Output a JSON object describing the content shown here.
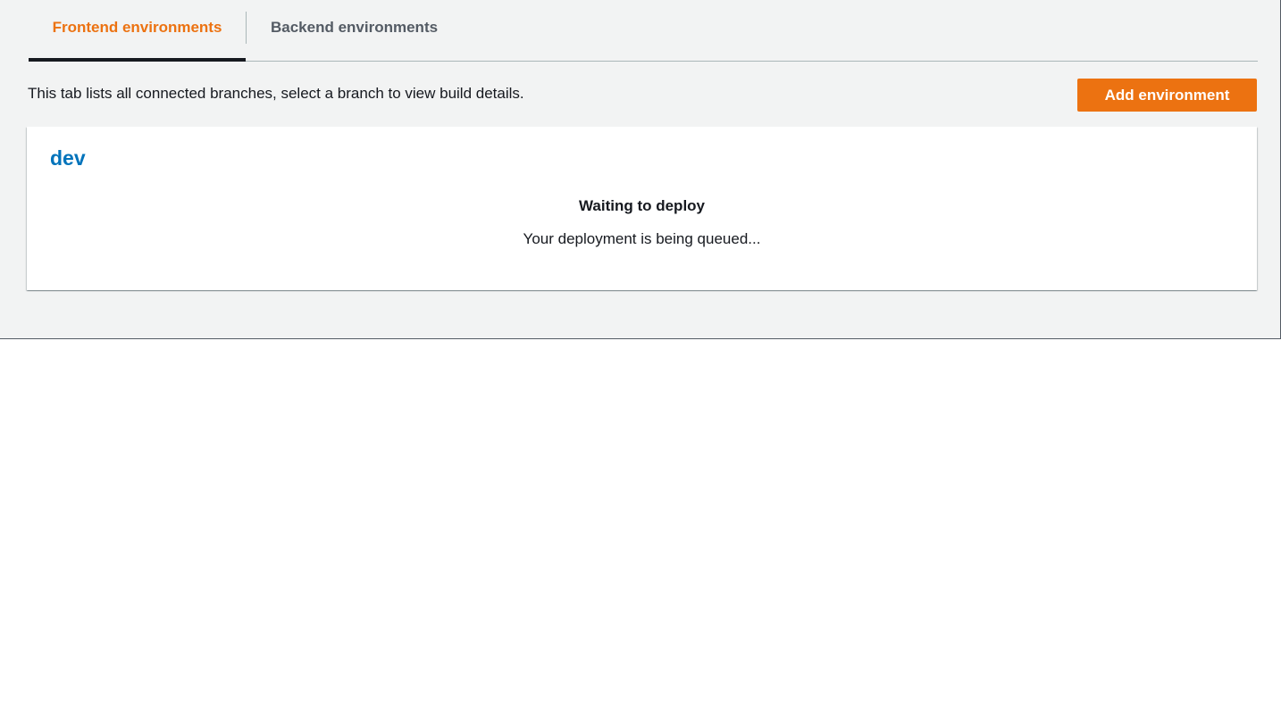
{
  "tabs": [
    {
      "label": "Frontend environments",
      "active": true
    },
    {
      "label": "Backend environments",
      "active": false
    }
  ],
  "description": "This tab lists all connected branches, select a branch to view build details.",
  "actions": {
    "add_environment_label": "Add environment"
  },
  "branch_card": {
    "branch_name": "dev",
    "status_title": "Waiting to deploy",
    "status_message": "Your deployment is being queued..."
  },
  "colors": {
    "accent": "#ec7211",
    "link": "#0073bb",
    "panel_background": "#f2f3f3",
    "text": "#16191f"
  }
}
